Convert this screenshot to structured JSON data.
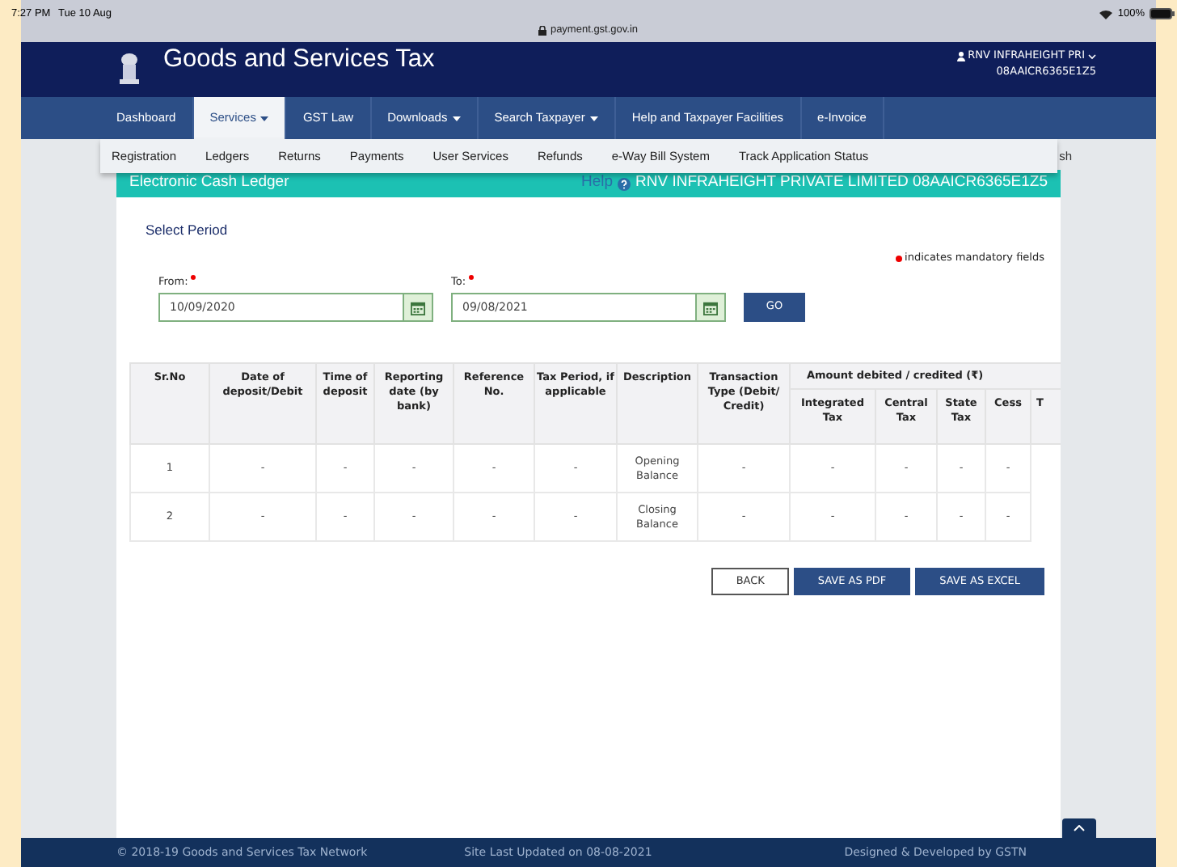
{
  "status_bar": {
    "time": "7:27 PM",
    "date": "Tue 10 Aug",
    "url": "payment.gst.gov.in",
    "battery": "100%"
  },
  "header": {
    "title": "Goods and Services Tax",
    "user": "RNV INFRAHEIGHT PRI",
    "gstin": "08AAICR6365E1Z5"
  },
  "nav": {
    "items": [
      {
        "label": "Dashboard",
        "dropdown": false,
        "selected": false
      },
      {
        "label": "Services",
        "dropdown": true,
        "selected": true
      },
      {
        "label": "GST Law",
        "dropdown": false,
        "selected": false
      },
      {
        "label": "Downloads",
        "dropdown": true,
        "selected": false
      },
      {
        "label": "Search Taxpayer",
        "dropdown": true,
        "selected": false
      },
      {
        "label": "Help and Taxpayer Facilities",
        "dropdown": false,
        "selected": false
      },
      {
        "label": "e-Invoice",
        "dropdown": false,
        "selected": false
      }
    ]
  },
  "submenu": {
    "items": [
      "Registration",
      "Ledgers",
      "Returns",
      "Payments",
      "User Services",
      "Refunds",
      "e-Way Bill System",
      "Track Application Status"
    ],
    "behind_text": "sh"
  },
  "page": {
    "title": "Electronic Cash Ledger",
    "help": "Help",
    "taxpayer": "RNV INFRAHEIGHT PRIVATE LIMITED 08AAICR6365E1Z5"
  },
  "form": {
    "section": "Select Period",
    "mandatory_note": "indicates mandatory fields",
    "from": {
      "label": "From:",
      "value": "10/09/2020"
    },
    "to": {
      "label": "To:",
      "value": "09/08/2021"
    },
    "go": "GO"
  },
  "table": {
    "columns": [
      "Sr.No",
      "Date of deposit/Debit",
      "Time of deposit",
      "Reporting date (by bank)",
      "Reference No.",
      "Tax Period, if applicable",
      "Description",
      "Transaction Type (Debit/ Credit)"
    ],
    "group": {
      "label": "Amount debited / credited (₹)",
      "columns": [
        "Integrated Tax",
        "Central Tax",
        "State Tax",
        "Cess",
        "T"
      ]
    },
    "rows": [
      [
        "1",
        "-",
        "-",
        "-",
        "-",
        "-",
        "Opening Balance",
        "-",
        "-",
        "-",
        "-",
        "-"
      ],
      [
        "2",
        "-",
        "-",
        "-",
        "-",
        "-",
        "Closing Balance",
        "-",
        "-",
        "-",
        "-",
        "-"
      ]
    ]
  },
  "buttons": [
    {
      "label": "BACK",
      "kind": "outline"
    },
    {
      "label": "SAVE AS PDF",
      "kind": "primary"
    },
    {
      "label": "SAVE AS EXCEL",
      "kind": "primary"
    }
  ],
  "footer": {
    "copyright": "© 2018-19 Goods and Services Tax Network",
    "updated": "Site Last Updated on 08-08-2021",
    "designed": "Designed & Developed by GSTN"
  }
}
